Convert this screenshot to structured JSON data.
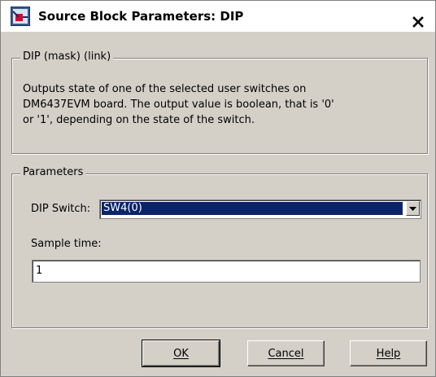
{
  "window": {
    "title": "Source Block Parameters: DIP",
    "close_glyph": "✕"
  },
  "mask_group": {
    "legend": "DIP (mask) (link)",
    "description": "Outputs state of one of the selected user switches on DM6437EVM board.  The output value is boolean, that is '0' or '1', depending on the state of the switch."
  },
  "params_group": {
    "legend": "Parameters",
    "dip_switch": {
      "label": "DIP Switch:",
      "value": "SW4(0)"
    },
    "sample_time": {
      "label": "Sample time:",
      "value": "1"
    }
  },
  "buttons": {
    "ok": "OK",
    "cancel": "Cancel",
    "help": "Help"
  },
  "colors": {
    "dialog_bg": "#d4d0c8",
    "selection": "#0a246a"
  },
  "icons": {
    "app": "simulink-block-icon",
    "close": "close-icon",
    "dropdown": "chevron-down-icon"
  }
}
